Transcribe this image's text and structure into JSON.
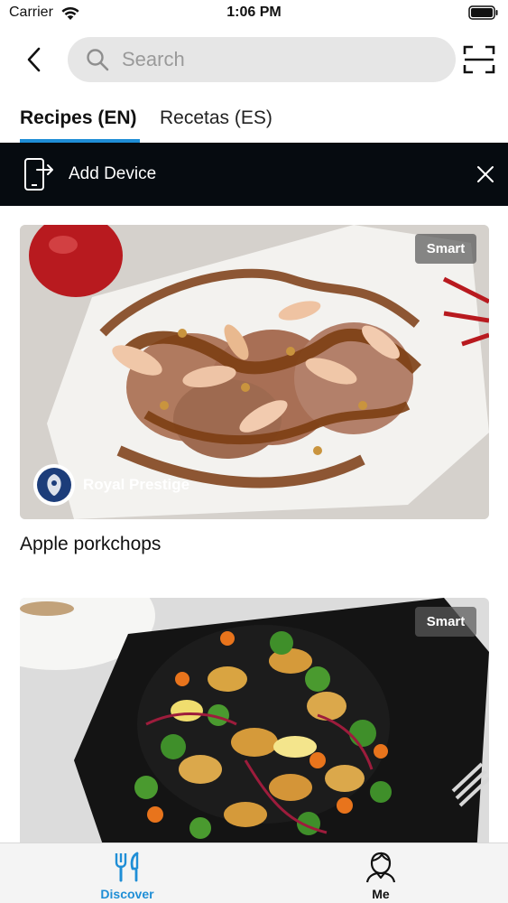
{
  "status_bar": {
    "carrier": "Carrier",
    "time": "1:06 PM"
  },
  "header": {
    "search_placeholder": "Search"
  },
  "tabs": [
    {
      "label": "Recipes (EN)",
      "active": true
    },
    {
      "label": "Recetas (ES)",
      "active": false
    }
  ],
  "banner": {
    "label": "Add Device"
  },
  "recipes": [
    {
      "title": "Apple porkchops",
      "badge": "Smart",
      "brand": "Royal Prestige"
    },
    {
      "title": "",
      "badge": "Smart",
      "brand": ""
    }
  ],
  "tabbar": [
    {
      "label": "Discover",
      "icon": "fork-knife-icon",
      "active": true
    },
    {
      "label": "Me",
      "icon": "person-icon",
      "active": false
    }
  ],
  "colors": {
    "accent": "#1f8ed6",
    "banner_bg": "#060b10",
    "search_bg": "#e6e6e6"
  }
}
